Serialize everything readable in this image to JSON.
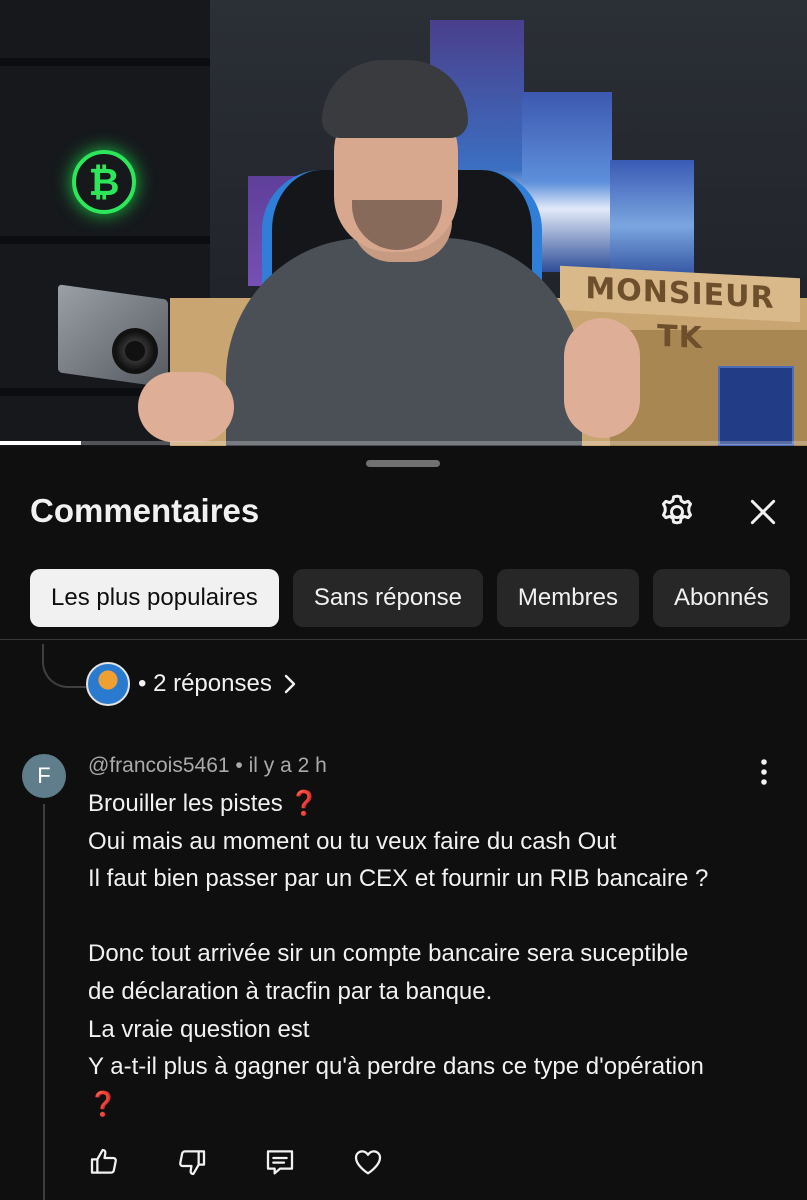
{
  "video": {
    "sign_text": "MONSIEUR TK",
    "logo_glyph": "₿",
    "progress_fraction": 0.1
  },
  "panel": {
    "title": "Commentaires",
    "icons": {
      "settings": "gear-icon",
      "close": "close-icon"
    },
    "filters": [
      {
        "label": "Les plus populaires",
        "selected": true
      },
      {
        "label": "Sans réponse",
        "selected": false
      },
      {
        "label": "Membres",
        "selected": false
      },
      {
        "label": "Abonnés",
        "selected": false
      }
    ]
  },
  "thread": {
    "replies_label": "• 2 réponses",
    "chevron": "chevron-right-icon"
  },
  "comment": {
    "avatar_letter": "F",
    "author": "@francois5461",
    "time": "• il y a 2 h",
    "lines": [
      "Brouiller les pistes ",
      "Oui mais au moment ou tu veux faire du cash Out",
      "Il faut bien passer par un CEX et fournir un RIB bancaire ?",
      "",
      "Donc tout arrivée sir un compte bancaire sera suceptible",
      "de déclaration à tracfin par ta banque.",
      "La vraie question est",
      "Y a-t-il plus à gagner qu'à perdre dans ce type d'opération",
      ""
    ],
    "emoji": "❓",
    "actions": [
      "like-icon",
      "dislike-icon",
      "reply-icon",
      "heart-icon"
    ]
  },
  "colors": {
    "background": "#0f0f0f",
    "chip_active": "#f1f1f1",
    "chip": "#272727",
    "meta_text": "#aaaaaa",
    "emoji_red": "#e0263b"
  }
}
